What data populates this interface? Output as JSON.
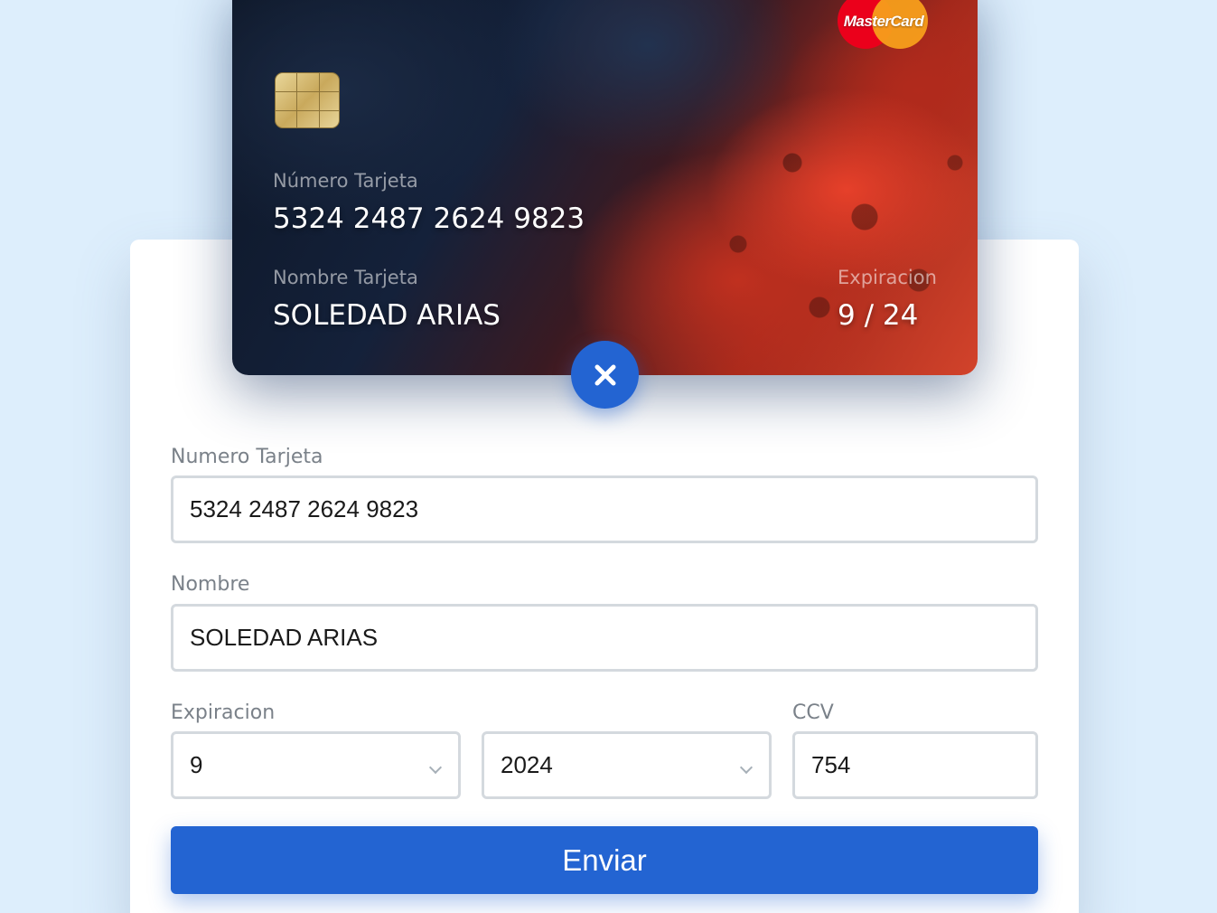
{
  "card": {
    "brand": "MasterCard",
    "number_label": "Número Tarjeta",
    "number": "5324 2487 2624 9823",
    "name_label": "Nombre Tarjeta",
    "name": "SOLEDAD ARIAS",
    "expiry_label": "Expiracion",
    "expiry": "9 / 24"
  },
  "close_button": {
    "icon": "close-icon"
  },
  "form": {
    "number_label": "Numero Tarjeta",
    "number_value": "5324 2487 2624 9823",
    "name_label": "Nombre",
    "name_value": "SOLEDAD ARIAS",
    "expiry_label": "Expiracion",
    "month_value": "9",
    "year_value": "2024",
    "ccv_label": "CCV",
    "ccv_value": "754",
    "submit_label": "Enviar"
  },
  "colors": {
    "background": "#ddeefc",
    "accent": "#2364d2"
  }
}
